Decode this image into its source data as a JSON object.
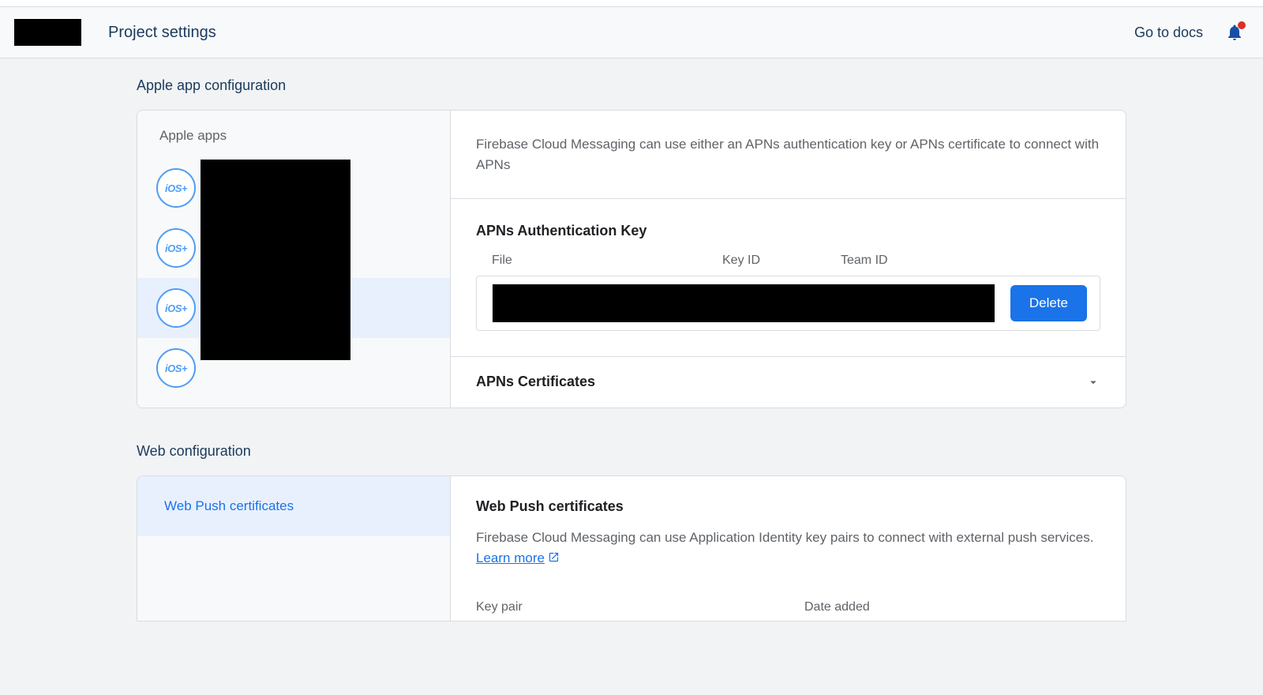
{
  "header": {
    "title": "Project settings",
    "docs_link": "Go to docs"
  },
  "apple": {
    "section_title": "Apple app configuration",
    "left_title": "Apple apps",
    "ios_badge": "iOS+",
    "lead": "Firebase Cloud Messaging can use either an APNs authentication key or APNs certificate to connect with APNs",
    "auth_key_heading": "APNs Authentication Key",
    "col_file": "File",
    "col_keyid": "Key ID",
    "col_teamid": "Team ID",
    "delete_label": "Delete",
    "cert_heading": "APNs Certificates"
  },
  "web": {
    "section_title": "Web configuration",
    "left_item": "Web Push certificates",
    "title": "Web Push certificates",
    "text": "Firebase Cloud Messaging can use Application Identity key pairs to connect with external push services. ",
    "learn_more": "Learn more",
    "col_keypair": "Key pair",
    "col_dateadded": "Date added"
  }
}
